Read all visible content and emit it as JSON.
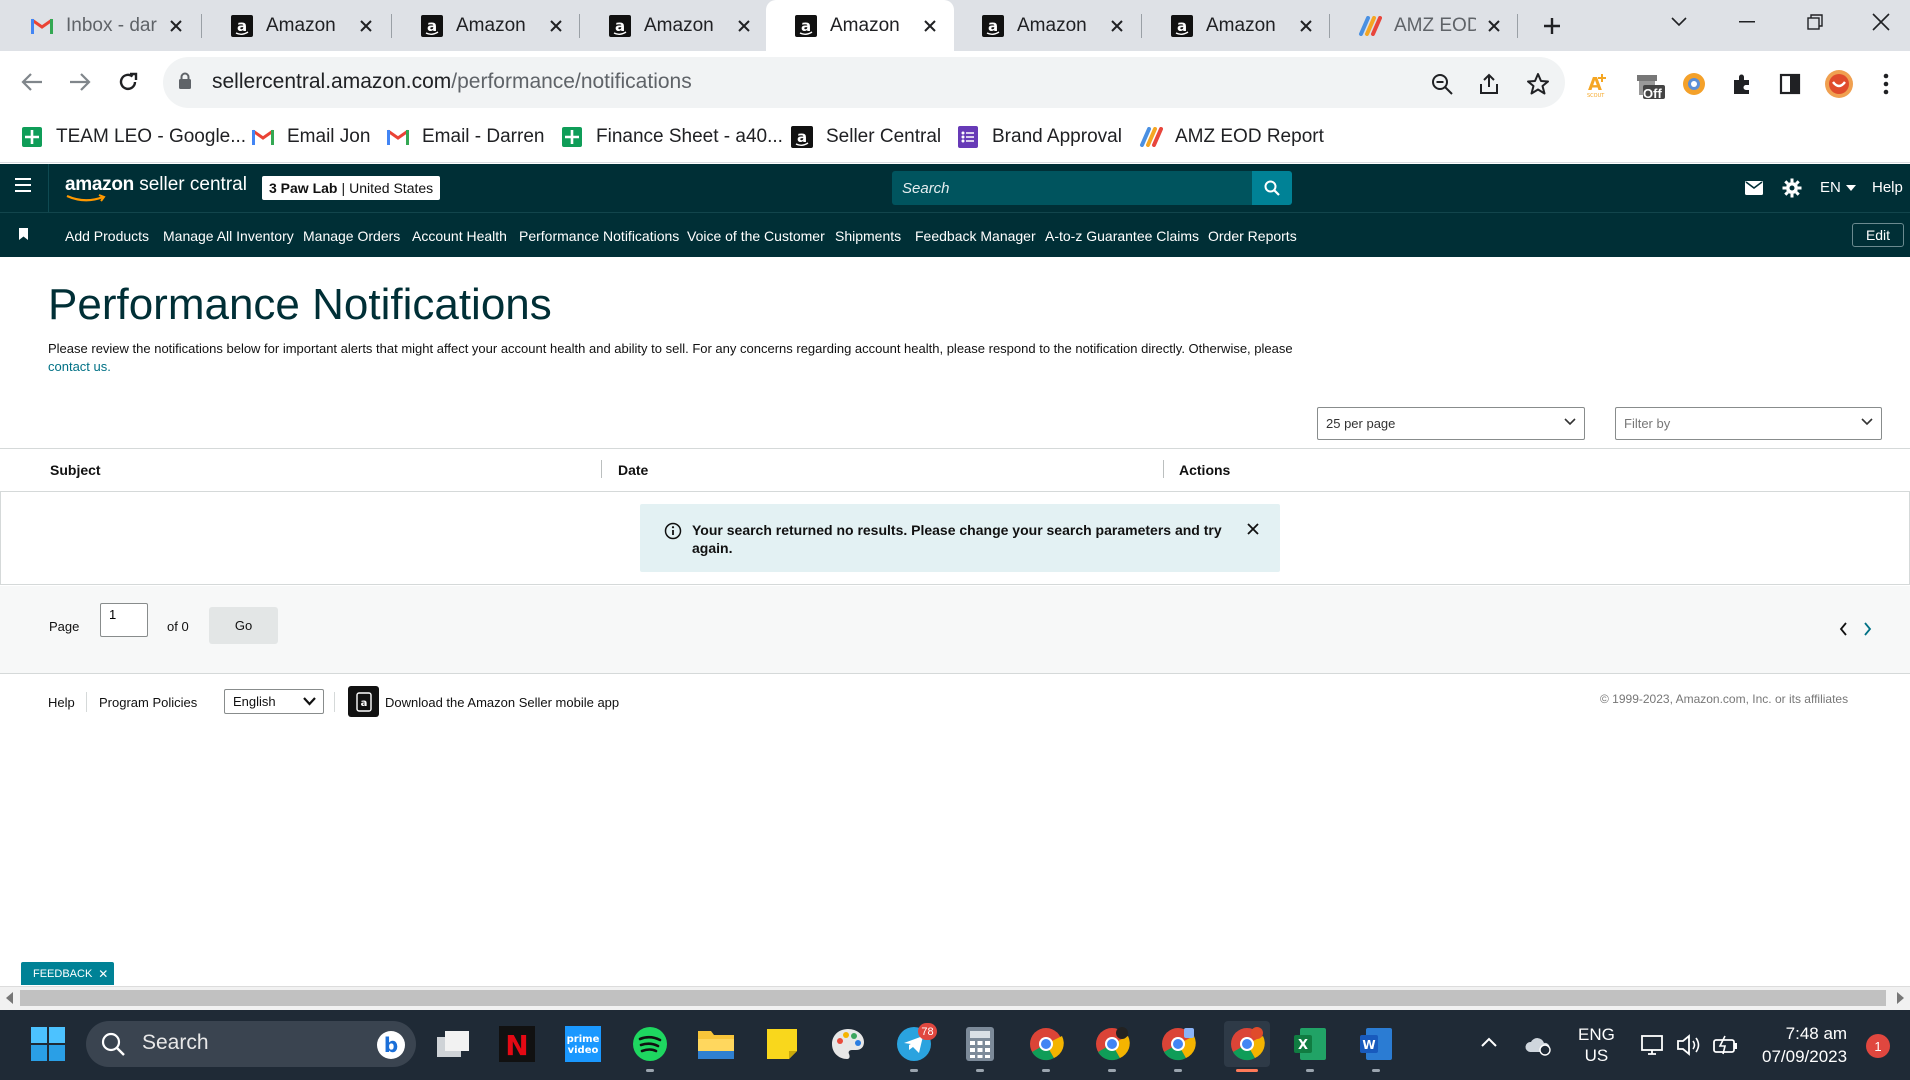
{
  "browser": {
    "tabs": [
      {
        "title": "Inbox - darr",
        "icon": "gmail-icon"
      },
      {
        "title": "Amazon",
        "icon": "amazon-icon"
      },
      {
        "title": "Amazon",
        "icon": "amazon-icon"
      },
      {
        "title": "Amazon",
        "icon": "amazon-icon"
      },
      {
        "title": "Amazon",
        "icon": "amazon-icon",
        "active": true
      },
      {
        "title": "Amazon",
        "icon": "amazon-icon"
      },
      {
        "title": "Amazon",
        "icon": "amazon-icon"
      },
      {
        "title": "AMZ EOD R",
        "icon": "asana-icon"
      }
    ],
    "url_host": "sellercentral.amazon.com",
    "url_path": "/performance/notifications",
    "bookmarks": [
      {
        "label": "TEAM LEO - Google...",
        "icon": "google-sheets-icon"
      },
      {
        "label": "Email Jon",
        "icon": "gmail-icon"
      },
      {
        "label": "Email - Darren",
        "icon": "gmail-icon"
      },
      {
        "label": "Finance Sheet - a40...",
        "icon": "google-sheets-icon"
      },
      {
        "label": "Seller Central",
        "icon": "amazon-icon"
      },
      {
        "label": "Brand Approval",
        "icon": "google-forms-icon"
      },
      {
        "label": "AMZ EOD Report",
        "icon": "asana-icon"
      }
    ],
    "extension_badge": "Off"
  },
  "seller_central": {
    "logo_brand": "amazon",
    "logo_product": "seller central",
    "store_name": "3 Paw Lab",
    "store_marketplace": "United States",
    "search_placeholder": "Search",
    "language": "EN",
    "help": "Help",
    "nav": [
      "Add Products",
      "Manage All Inventory",
      "Manage Orders",
      "Account Health",
      "Performance Notifications",
      "Voice of the Customer",
      "Shipments",
      "Feedback Manager",
      "A-to-z Guarantee Claims",
      "Order Reports"
    ],
    "nav_edit": "Edit"
  },
  "page": {
    "title": "Performance Notifications",
    "description": "Please review the notifications below for important alerts that might affect your account health and ability to sell. For any concerns regarding account health, please respond to the notification directly. Otherwise, please",
    "description_link": "contact us.",
    "per_page": "25 per page",
    "filter_placeholder": "Filter by",
    "columns": [
      "Subject",
      "Date",
      "Actions"
    ],
    "alert": "Your search returned no results. Please change your search parameters and try again.",
    "pager": {
      "page_label": "Page",
      "page_value": "1",
      "of_label": "of 0",
      "go_label": "Go"
    }
  },
  "footer": {
    "help": "Help",
    "policies": "Program Policies",
    "language": "English",
    "app_link": "Download the Amazon Seller mobile app",
    "copyright": "© 1999-2023, Amazon.com, Inc. or its affiliates",
    "feedback": "FEEDBACK"
  },
  "taskbar": {
    "search": "Search",
    "telegram_badge": "78",
    "lang_line1": "ENG",
    "lang_line2": "US",
    "time": "7:48 am",
    "date": "07/09/2023",
    "notifications": "1"
  },
  "colors": {
    "header": "#002f36",
    "accent": "#008296",
    "link": "#007185",
    "alert_bg": "#e3f1f3"
  }
}
